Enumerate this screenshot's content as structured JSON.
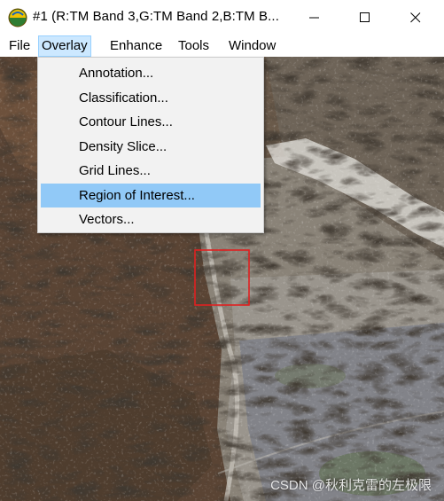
{
  "window": {
    "title": "#1 (R:TM Band 3,G:TM Band 2,B:TM B...",
    "minimize_icon": "minimize-icon",
    "maximize_icon": "maximize-icon",
    "close_icon": "close-icon"
  },
  "menubar": {
    "items": [
      {
        "label": "File"
      },
      {
        "label": "Overlay"
      },
      {
        "label": "Enhance"
      },
      {
        "label": "Tools"
      },
      {
        "label": "Window"
      }
    ],
    "active": "Overlay"
  },
  "overlay_menu": {
    "items": [
      {
        "label": "Annotation..."
      },
      {
        "label": "Classification..."
      },
      {
        "label": "Contour Lines..."
      },
      {
        "label": "Density Slice..."
      },
      {
        "label": "Grid Lines..."
      },
      {
        "label": "Region of Interest..."
      },
      {
        "label": "Vectors..."
      }
    ],
    "highlighted": "Region of Interest..."
  },
  "image": {
    "roi_color": "#e02020"
  },
  "watermark": "CSDN @秋利克雷的左极限"
}
